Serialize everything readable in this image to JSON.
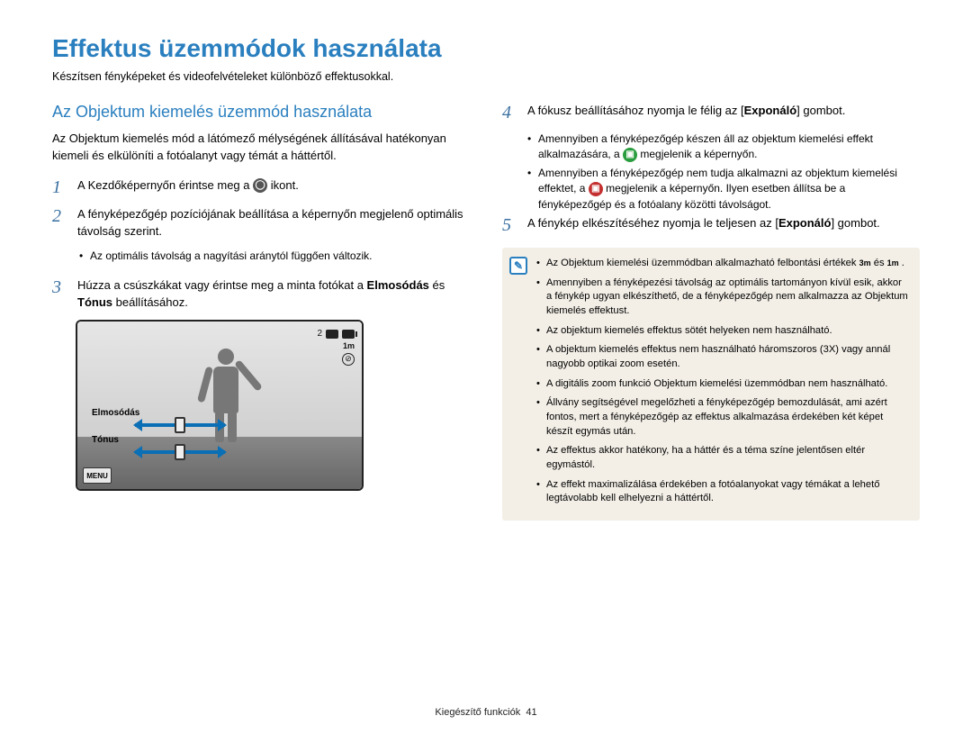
{
  "title": "Effektus üzemmódok használata",
  "subtitle": "Készítsen fényképeket és videofelvételeket különböző effektusokkal.",
  "left": {
    "heading": "Az Objektum kiemelés üzemmód használata",
    "intro": "Az Objektum kiemelés mód a látómező mélységének állításával hatékonyan kiemeli és elkülöníti a fotóalanyt vagy témát a háttértől.",
    "steps": [
      {
        "num": "1",
        "pre": "A Kezdőképernyőn érintse meg a ",
        "post": " ikont."
      },
      {
        "num": "2",
        "text": "A fényképezőgép pozíciójának beállítása a képernyőn megjelenő optimális távolság szerint."
      },
      {
        "num": "3",
        "pre": "Húzza a csúszkákat vagy érintse meg a minta fotókat a ",
        "bold": "Elmosódás",
        "mid": " és ",
        "bold2": "Tónus",
        "post2": " beállításához."
      }
    ],
    "step2_bullets": [
      "Az optimális távolság a nagyítási aránytól függően változik."
    ],
    "camera": {
      "label_blur": "Elmosódás",
      "label_tone": "Tónus",
      "menu": "MENU",
      "shots": "2",
      "res": "1m"
    }
  },
  "right": {
    "steps": [
      {
        "num": "4",
        "pre": "A fókusz beállításához nyomja le félig az [",
        "bold": "Exponáló",
        "post": "] gombot."
      },
      {
        "num": "5",
        "pre": "A fénykép elkészítéséhez nyomja le teljesen az [",
        "bold": "Exponáló",
        "post": "] gombot."
      }
    ],
    "step4_bullets": [
      {
        "pre": "Amennyiben a fényképezőgép készen áll az objektum kiemelési effekt alkalmazására, a ",
        "post": " megjelenik a képernyőn."
      },
      {
        "pre": "Amennyiben a fényképezőgép nem tudja alkalmazni az objektum kiemelési effektet, a ",
        "post": " megjelenik a képernyőn. Ilyen esetben állítsa be a fényképezőgép és a fotóalany közötti távolságot."
      }
    ],
    "note_items": [
      {
        "pre": "Az Objektum kiemelési üzemmódban alkalmazható felbontási értékek ",
        "bold1": "3m",
        "mid": " és ",
        "bold2": "1m",
        "post": "."
      },
      {
        "text": "Amennyiben a fényképezési távolság az optimális tartományon kívül esik, akkor a fénykép ugyan elkészíthető, de a fényképezőgép nem alkalmazza az Objektum kiemelés effektust."
      },
      {
        "text": "Az objektum kiemelés effektus sötét helyeken nem használható."
      },
      {
        "text": "A objektum kiemelés effektus nem használható háromszoros (3X) vagy annál nagyobb optikai zoom esetén."
      },
      {
        "text": "A digitális zoom funkció Objektum kiemelési üzemmódban nem használható."
      },
      {
        "text": "Állvány segítségével megelőzheti a fényképezőgép bemozdulását, ami azért fontos, mert a fényképezőgép az effektus alkalmazása érdekében két képet készít egymás után."
      },
      {
        "text": "Az effektus akkor hatékony, ha a háttér és a téma színe jelentősen eltér egymástól."
      },
      {
        "text": "Az effekt maximalizálása érdekében a fotóalanyokat vagy témákat a lehető legtávolabb kell elhelyezni a háttértől."
      }
    ]
  },
  "footer": {
    "section": "Kiegészítő funkciók",
    "page": "41"
  }
}
